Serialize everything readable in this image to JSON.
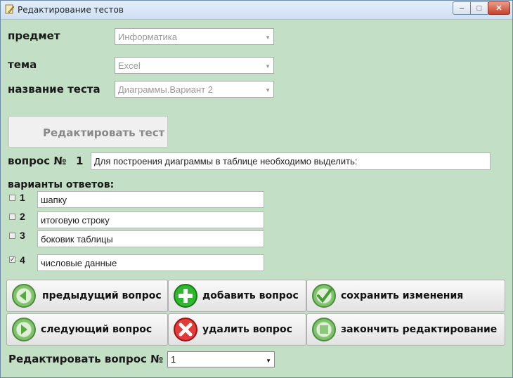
{
  "window": {
    "title": "Редактирование тестов"
  },
  "labels": {
    "subject": "предмет",
    "topic": "тема",
    "test_name": "название теста",
    "question_no": "вопрос №",
    "answer_variants": "варианты ответов:",
    "edit_question_no": "Редактировать вопрос №"
  },
  "subject": {
    "value": "Информатика"
  },
  "topic": {
    "value": "Excel"
  },
  "test": {
    "value": "Диаграммы.Вариант 2"
  },
  "edit_test_button": "Редактировать тест",
  "question": {
    "number": "1",
    "text": "Для построения диаграммы в таблице необходимо выделить:"
  },
  "answers": [
    {
      "num": "1",
      "text": "шапку",
      "checked": false
    },
    {
      "num": "2",
      "text": "итоговую строку",
      "checked": false
    },
    {
      "num": "3",
      "text": "боковик таблицы",
      "checked": false
    },
    {
      "num": "4",
      "text": "числовые данные",
      "checked": true
    }
  ],
  "buttons": {
    "prev": "предыдущий вопрос",
    "add": "добавить вопрос",
    "save": "сохранить изменения",
    "next": "следующий вопрос",
    "delete": "удалить вопрос",
    "finish": "закончить редактирование"
  },
  "edit_question_select": {
    "value": "1"
  },
  "icons": {
    "app": "app-pencil-icon",
    "prev": "arrow-left-icon",
    "add": "plus-icon",
    "save": "checkmark-icon",
    "next": "arrow-right-icon",
    "delete": "x-icon",
    "finish": "stop-square-icon"
  }
}
